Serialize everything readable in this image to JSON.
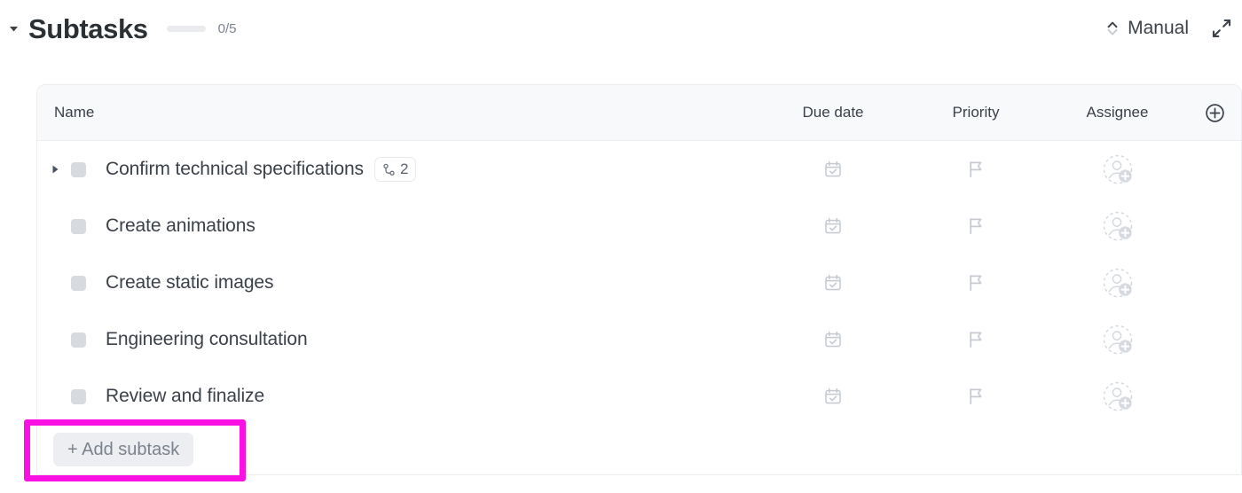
{
  "section": {
    "title": "Subtasks",
    "progress_count": "0/5",
    "progress_percent": 0,
    "sort_label": "Manual"
  },
  "table": {
    "columns": {
      "name": "Name",
      "due_date": "Due date",
      "priority": "Priority",
      "assignee": "Assignee"
    },
    "rows": [
      {
        "name": "Confirm technical specifications",
        "has_disclosure": true,
        "subtask_count": "2",
        "due_date": "",
        "priority": "",
        "assignee": ""
      },
      {
        "name": "Create animations",
        "has_disclosure": false,
        "subtask_count": "",
        "due_date": "",
        "priority": "",
        "assignee": ""
      },
      {
        "name": "Create static images",
        "has_disclosure": false,
        "subtask_count": "",
        "due_date": "",
        "priority": "",
        "assignee": ""
      },
      {
        "name": "Engineering consultation",
        "has_disclosure": false,
        "subtask_count": "",
        "due_date": "",
        "priority": "",
        "assignee": ""
      },
      {
        "name": "Review and finalize",
        "has_disclosure": false,
        "subtask_count": "",
        "due_date": "",
        "priority": "",
        "assignee": ""
      }
    ]
  },
  "footer": {
    "add_subtask_label": "+ Add subtask"
  },
  "colors": {
    "highlight": "#fa10e3",
    "text_primary": "#3b4149",
    "text_muted": "#7c828d",
    "header_bg": "#f8f9fb",
    "border": "#ecedf0",
    "checkbox": "#d7dade",
    "placeholder_icon": "#c6cbd4"
  },
  "icons": {
    "collapse": "caret-down-icon",
    "sort": "sort-chevrons-icon",
    "expand": "expand-arrows-icon",
    "add_column": "plus-circle-icon",
    "due_date": "calendar-check-icon",
    "priority": "flag-icon",
    "assignee": "add-assignee-icon",
    "subtask": "subtask-branch-icon"
  }
}
